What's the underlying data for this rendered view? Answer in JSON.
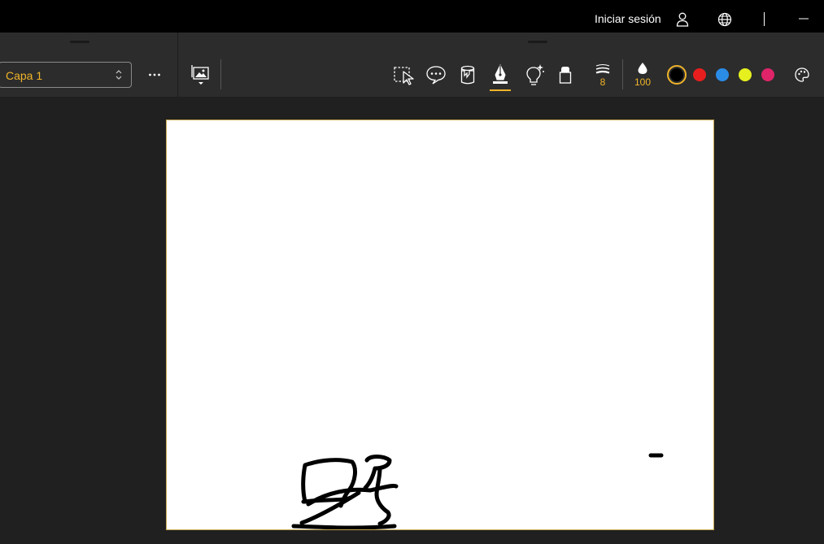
{
  "titlebar": {
    "signin_label": "Iniciar sesión",
    "icons": [
      "user-icon",
      "globe-icon",
      "minimize-icon"
    ]
  },
  "toolbar": {
    "layer_select": {
      "value": "Capa 1"
    },
    "more_icon": "more-horizontal-icon",
    "insert_image_icon": "image-folder-icon",
    "tools": [
      {
        "name": "select-tool",
        "icon": "lasso-select-icon"
      },
      {
        "name": "comment-tool",
        "icon": "speech-bubble-icon"
      },
      {
        "name": "fill-tool",
        "icon": "paint-bucket-icon"
      },
      {
        "name": "pen-tool",
        "icon": "pen-nib-icon",
        "active": true
      },
      {
        "name": "highlight-tool",
        "icon": "lightbulb-icon"
      },
      {
        "name": "eraser-tool",
        "icon": "eraser-icon"
      }
    ],
    "stroke_size": "8",
    "opacity": "100",
    "colors": [
      {
        "name": "black",
        "hex": "#000000",
        "selected": true
      },
      {
        "name": "red",
        "hex": "#e81e1e"
      },
      {
        "name": "blue",
        "hex": "#2b8ce6"
      },
      {
        "name": "yellow",
        "hex": "#e6f01e"
      },
      {
        "name": "pink",
        "hex": "#e0246a"
      }
    ],
    "palette_icon": "palette-icon"
  },
  "accent_color": "#f0b429"
}
